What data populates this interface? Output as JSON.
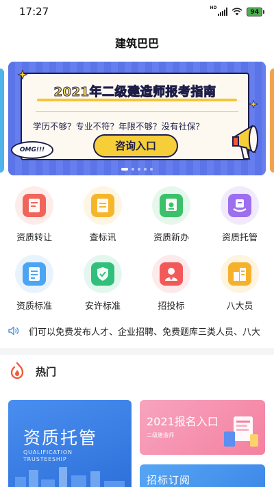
{
  "status_bar": {
    "time": "17:27",
    "network": "HD",
    "battery": "94"
  },
  "header": {
    "title": "建筑巴巴"
  },
  "banner": {
    "headline": "2021年二级建造师报考指南",
    "subline": "学历不够？专业不符？年限不够？没有社保？",
    "cta_label": "咨询入口",
    "bubble": "OMG!!!",
    "slide_count": 5,
    "active_slide": 1
  },
  "grid": {
    "items": [
      {
        "label": "资质转让",
        "icon": "document-red-icon",
        "color": "#f0645a",
        "bg": "#fdecea"
      },
      {
        "label": "查标讯",
        "icon": "document-orange-icon",
        "color": "#f6b62c",
        "bg": "#fef5e2"
      },
      {
        "label": "资质新办",
        "icon": "stamp-document-icon",
        "color": "#3cc16a",
        "bg": "#e6f7ec"
      },
      {
        "label": "资质托管",
        "icon": "hand-document-icon",
        "color": "#9c6ef0",
        "bg": "#f1eafd"
      },
      {
        "label": "资质标准",
        "icon": "checklist-document-icon",
        "color": "#4ba5f3",
        "bg": "#e8f3fd"
      },
      {
        "label": "安许标准",
        "icon": "shield-icon",
        "color": "#31c07c",
        "bg": "#e4f7ee"
      },
      {
        "label": "招投标",
        "icon": "person-icon",
        "color": "#f25a5a",
        "bg": "#fdeaea"
      },
      {
        "label": "八大员",
        "icon": "buildings-icon",
        "color": "#f6b12c",
        "bg": "#fef4e0"
      }
    ]
  },
  "notice": {
    "text": "们可以免费发布人才、企业招聘、免费题库三类人员、八大"
  },
  "hot": {
    "title": "热门",
    "big_promo": {
      "title": "资质托管",
      "en_line1": "QUALIFICATION",
      "en_line2": "TRUSTEESHIP"
    },
    "promo_top": {
      "title": "2021报名入口",
      "subtitle": "二级建造师"
    },
    "promo_bottom": {
      "title": "招标订阅"
    }
  },
  "colors": {
    "accent": "#2c6fd8",
    "hot": "#f15a3a",
    "notice_icon": "#4a90e2"
  }
}
